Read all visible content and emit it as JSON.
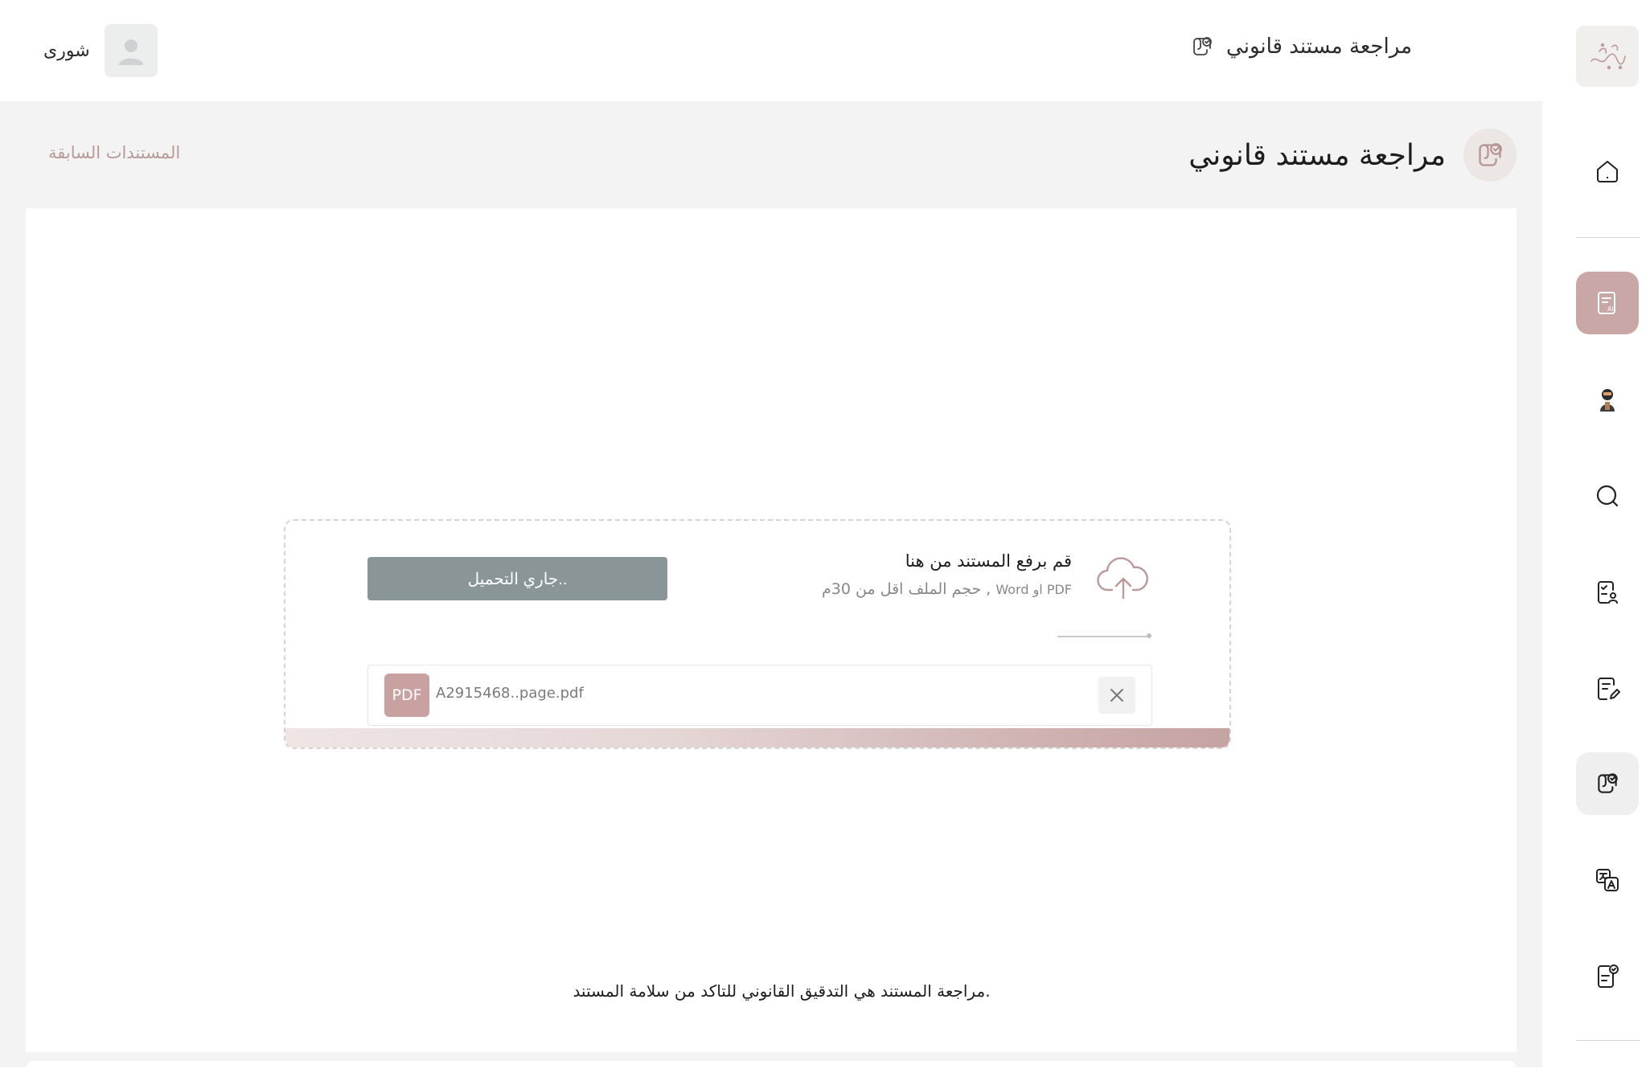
{
  "header": {
    "title": "مراجعة مستند قانوني",
    "user_name": "شورى"
  },
  "page": {
    "title": "مراجعة مستند قانوني",
    "previous_docs_link": "المستندات السابقة"
  },
  "upload": {
    "title": "قم برفع المستند من هنا",
    "hint_main": "حجم الملف اقل من 30م ,",
    "hint_types": "Word او PDF",
    "button_label": "جاري التحميل..",
    "file": {
      "badge": "PDF",
      "name": "A2915468..page.pdf"
    }
  },
  "description": "مراجعة المستند هي التدقيق القانوني للتاكد من سلامة المستند.",
  "sidebar": {
    "items": [
      {
        "icon": "home-icon"
      },
      {
        "icon": "ai-document-icon",
        "active": true
      },
      {
        "icon": "assistant-avatar-icon"
      },
      {
        "icon": "search-icon"
      },
      {
        "icon": "document-user-icon"
      },
      {
        "icon": "document-edit-icon"
      },
      {
        "icon": "legal-review-icon",
        "current": true
      },
      {
        "icon": "translate-icon"
      },
      {
        "icon": "checklist-icon"
      }
    ]
  },
  "colors": {
    "accent": "#c9a7a7",
    "button": "#899597",
    "pdf_badge": "#c9a1a0",
    "background": "#f3f3f3"
  }
}
